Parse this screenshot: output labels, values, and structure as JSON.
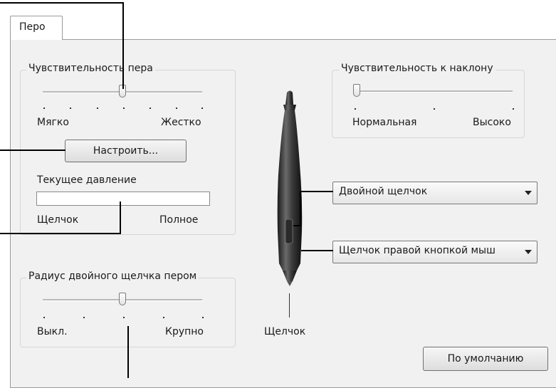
{
  "tab": {
    "label": "Перо"
  },
  "pen_sensitivity": {
    "title": "Чувствительность пера",
    "slider_level": 0.5,
    "min_label": "Мягко",
    "max_label": "Жестко",
    "customize_button": "Настроить...",
    "current_pressure_label": "Текущее давление",
    "current_pressure_value": "",
    "click_label": "Щелчок",
    "full_label": "Полное"
  },
  "tilt_sensitivity": {
    "title": "Чувствительность к наклону",
    "slider_level": 0.0,
    "min_label": "Нормальная",
    "max_label": "Высоко"
  },
  "double_click_radius": {
    "title": "Радиус двойного щелчка пером",
    "slider_level": 0.5,
    "min_label": "Выкл.",
    "max_label": "Крупно"
  },
  "pen_buttons": {
    "upper_button_value": "Двойной щелчок",
    "lower_button_value": "Щелчок правой кнопкой мыш",
    "tip_label": "Щелчок"
  },
  "default_button": "По умолчанию",
  "icons": {
    "dropdown": "chevron-down-icon",
    "pen": "pen-icon"
  }
}
